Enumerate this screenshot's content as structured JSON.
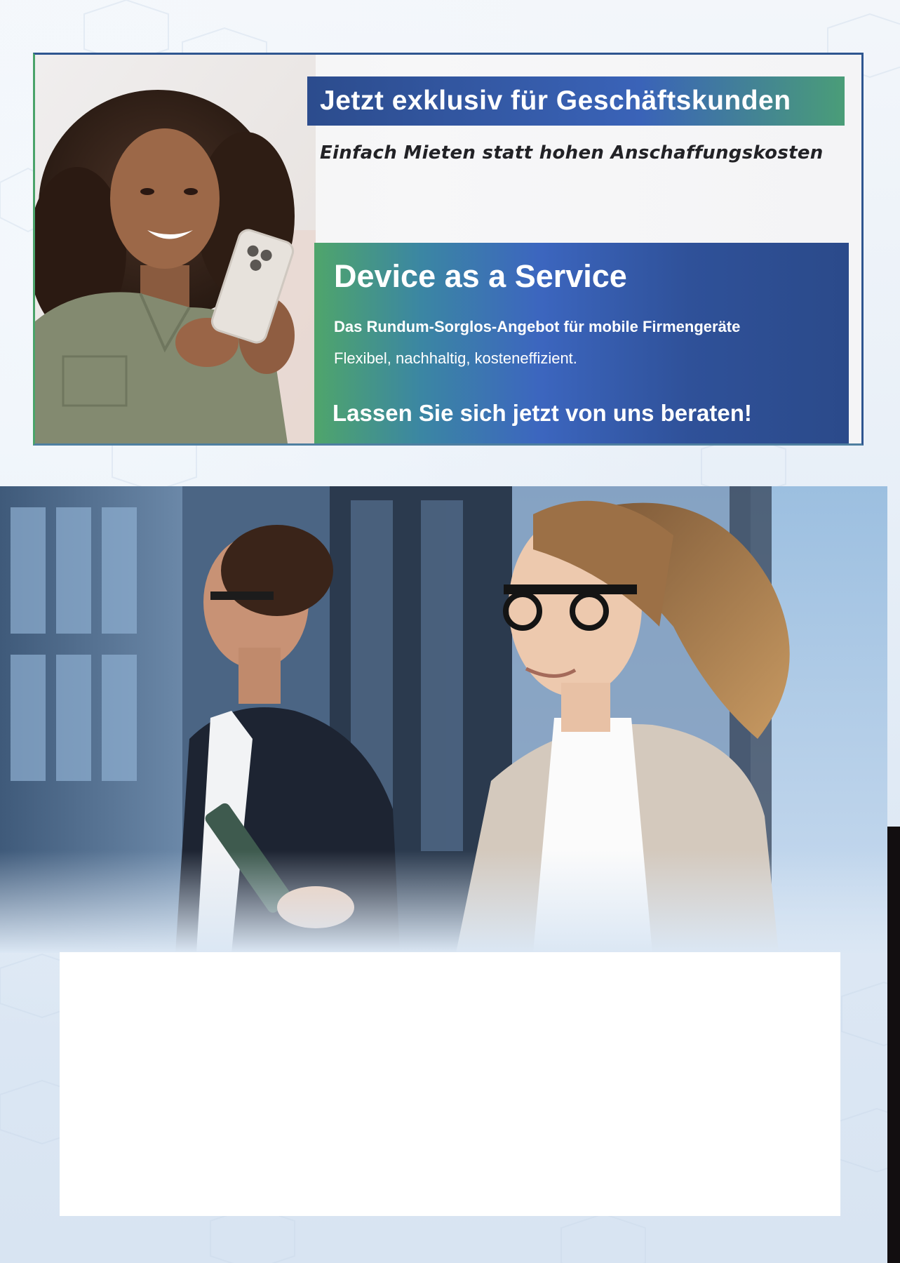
{
  "banner": {
    "headline": "Jetzt exklusiv für Geschäftskunden",
    "subheadline": "Einfach Mieten statt hohen Anschaffungskosten",
    "offer": {
      "title": "Device as a Service",
      "subtitle": "Das Rundum-Sorglos-Angebot für mobile Firmengeräte",
      "description": "Flexibel, nachhaltig, kosteneffizient.",
      "cta": "Lassen Sie sich jetzt von uns beraten!"
    }
  },
  "images": {
    "banner_photo": "woman-with-smartphone-photo",
    "hero_photo": "business-people-walking-photo"
  },
  "colors": {
    "brand_blue": "#2c4c8d",
    "brand_mid_blue": "#3c66bf",
    "brand_green": "#4fa56b",
    "white": "#ffffff"
  }
}
